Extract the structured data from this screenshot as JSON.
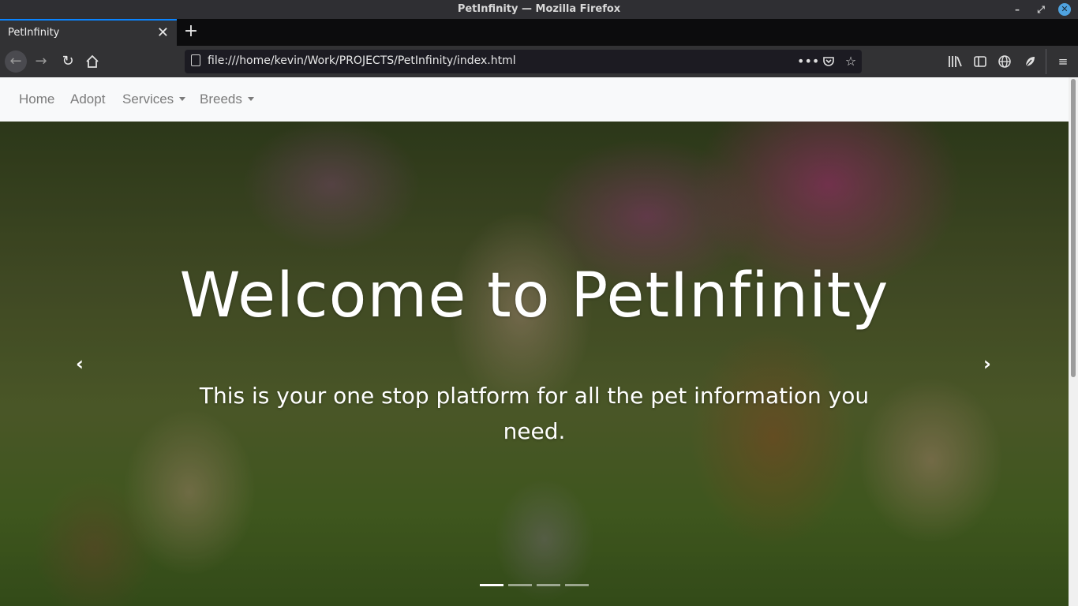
{
  "window": {
    "title": "PetInfinity — Mozilla Firefox"
  },
  "tabs": [
    {
      "label": "PetInfinity",
      "active": true
    }
  ],
  "urlbar": {
    "url": "file:///home/kevin/Work/PROJECTS/PetInfinity/index.html"
  },
  "site_nav": {
    "items": [
      {
        "label": "Home",
        "dropdown": false
      },
      {
        "label": "Adopt",
        "dropdown": false
      },
      {
        "label": "Services",
        "dropdown": true
      },
      {
        "label": "Breeds",
        "dropdown": true
      }
    ]
  },
  "hero": {
    "title": "Welcome to PetInfinity",
    "subtitle": "This is your one stop platform for all the pet information you need.",
    "slide_count": 4,
    "active_slide": 1
  },
  "icons": {
    "back": "arrow-left-icon",
    "forward": "arrow-right-icon",
    "reload": "reload-icon",
    "home": "home-icon",
    "library": "library-icon",
    "sidebar": "sidebar-icon",
    "globe": "globe-icon",
    "extension": "leaf-icon",
    "menu": "hamburger-icon"
  },
  "colors": {
    "tab_accent": "#0a84ff",
    "nav_bg": "#f8f9fa",
    "nav_link": "#7b7b7b"
  }
}
